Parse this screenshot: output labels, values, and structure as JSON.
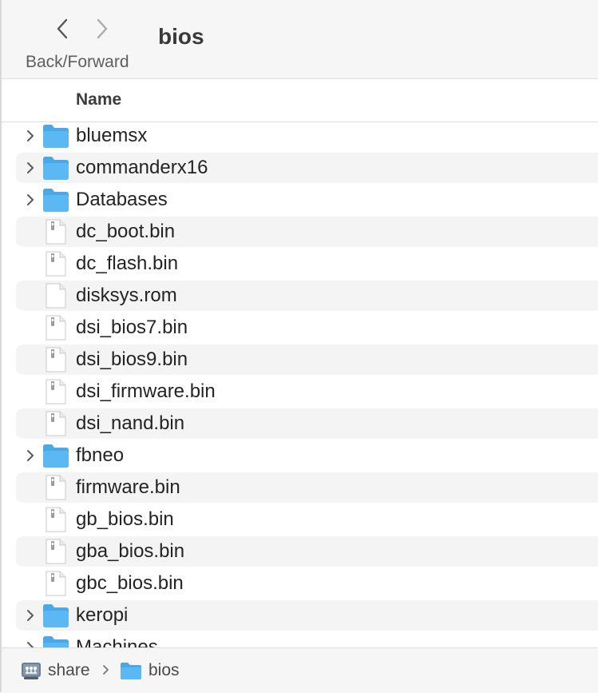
{
  "toolbar": {
    "nav_label": "Back/Forward",
    "title": "bios"
  },
  "columns": {
    "name": "Name"
  },
  "files": [
    {
      "name": "bluemsx",
      "kind": "folder"
    },
    {
      "name": "commanderx16",
      "kind": "folder"
    },
    {
      "name": "Databases",
      "kind": "folder"
    },
    {
      "name": "dc_boot.bin",
      "kind": "exec"
    },
    {
      "name": "dc_flash.bin",
      "kind": "exec"
    },
    {
      "name": "disksys.rom",
      "kind": "doc"
    },
    {
      "name": "dsi_bios7.bin",
      "kind": "exec"
    },
    {
      "name": "dsi_bios9.bin",
      "kind": "exec"
    },
    {
      "name": "dsi_firmware.bin",
      "kind": "exec"
    },
    {
      "name": "dsi_nand.bin",
      "kind": "exec"
    },
    {
      "name": "fbneo",
      "kind": "folder"
    },
    {
      "name": "firmware.bin",
      "kind": "exec"
    },
    {
      "name": "gb_bios.bin",
      "kind": "exec"
    },
    {
      "name": "gba_bios.bin",
      "kind": "exec"
    },
    {
      "name": "gbc_bios.bin",
      "kind": "exec"
    },
    {
      "name": "keropi",
      "kind": "folder"
    },
    {
      "name": "Machines",
      "kind": "folder"
    }
  ],
  "pathbar": {
    "items": [
      {
        "label": "share",
        "icon": "network-drive-icon"
      },
      {
        "label": "bios",
        "icon": "folder-icon"
      }
    ]
  },
  "colors": {
    "folder": "#5bb8f2",
    "folder_tab": "#4aa8e8",
    "row_alt": "#f4f4f4",
    "chrome": "#f6f6f6"
  }
}
